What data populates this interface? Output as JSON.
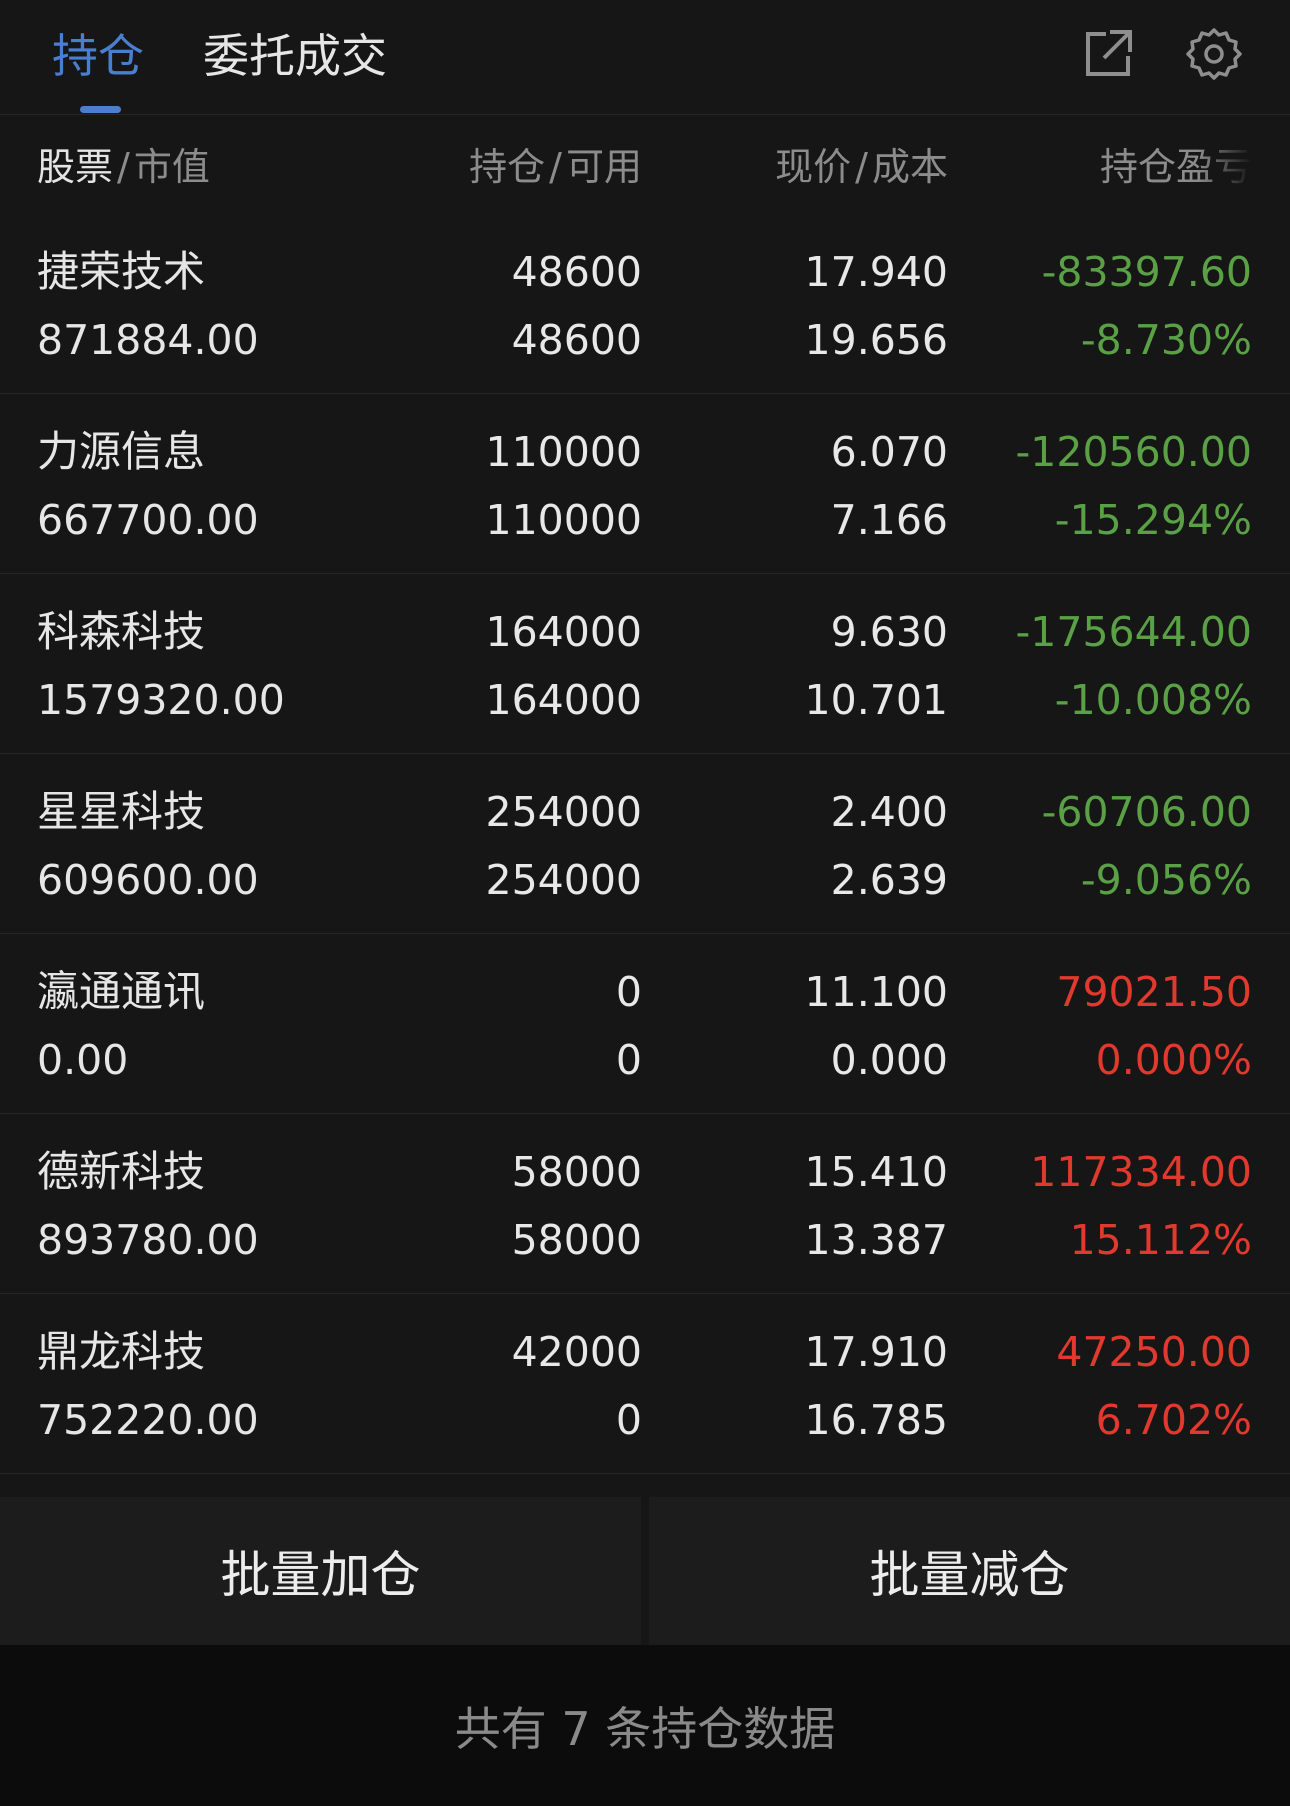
{
  "tabs": [
    {
      "label": "持仓"
    },
    {
      "label": "委托成交"
    }
  ],
  "table_header": {
    "stock": "股票",
    "market_value": "市值",
    "holding": "持仓",
    "available": "可用",
    "price": "现价",
    "cost": "成本",
    "profit_loss": "持仓盈亏"
  },
  "positions": [
    {
      "name": "捷荣技术",
      "market_value": "871884.00",
      "holding": "48600",
      "available": "48600",
      "price": "17.940",
      "cost": "19.656",
      "pl": "-83397.60",
      "pl_pct": "-8.730%",
      "trend": "down"
    },
    {
      "name": "力源信息",
      "market_value": "667700.00",
      "holding": "110000",
      "available": "110000",
      "price": "6.070",
      "cost": "7.166",
      "pl": "-120560.00",
      "pl_pct": "-15.294%",
      "trend": "down"
    },
    {
      "name": "科森科技",
      "market_value": "1579320.00",
      "holding": "164000",
      "available": "164000",
      "price": "9.630",
      "cost": "10.701",
      "pl": "-175644.00",
      "pl_pct": "-10.008%",
      "trend": "down"
    },
    {
      "name": "星星科技",
      "market_value": "609600.00",
      "holding": "254000",
      "available": "254000",
      "price": "2.400",
      "cost": "2.639",
      "pl": "-60706.00",
      "pl_pct": "-9.056%",
      "trend": "down"
    },
    {
      "name": "瀛通通讯",
      "market_value": "0.00",
      "holding": "0",
      "available": "0",
      "price": "11.100",
      "cost": "0.000",
      "pl": "79021.50",
      "pl_pct": "0.000%",
      "trend": "up"
    },
    {
      "name": "德新科技",
      "market_value": "893780.00",
      "holding": "58000",
      "available": "58000",
      "price": "15.410",
      "cost": "13.387",
      "pl": "117334.00",
      "pl_pct": "15.112%",
      "trend": "up"
    },
    {
      "name": "鼎龙科技",
      "market_value": "752220.00",
      "holding": "42000",
      "available": "0",
      "price": "17.910",
      "cost": "16.785",
      "pl": "47250.00",
      "pl_pct": "6.702%",
      "trend": "up"
    }
  ],
  "buttons": {
    "batch_add": "批量加仓",
    "batch_reduce": "批量减仓"
  },
  "footer": {
    "summary": "共有 7 条持仓数据"
  },
  "colors": {
    "accent": "#4a7fd0",
    "loss": "#5aa145",
    "gain": "#e0392d",
    "background": "#161616"
  },
  "icons": [
    "share-icon",
    "settings-gear-icon"
  ]
}
